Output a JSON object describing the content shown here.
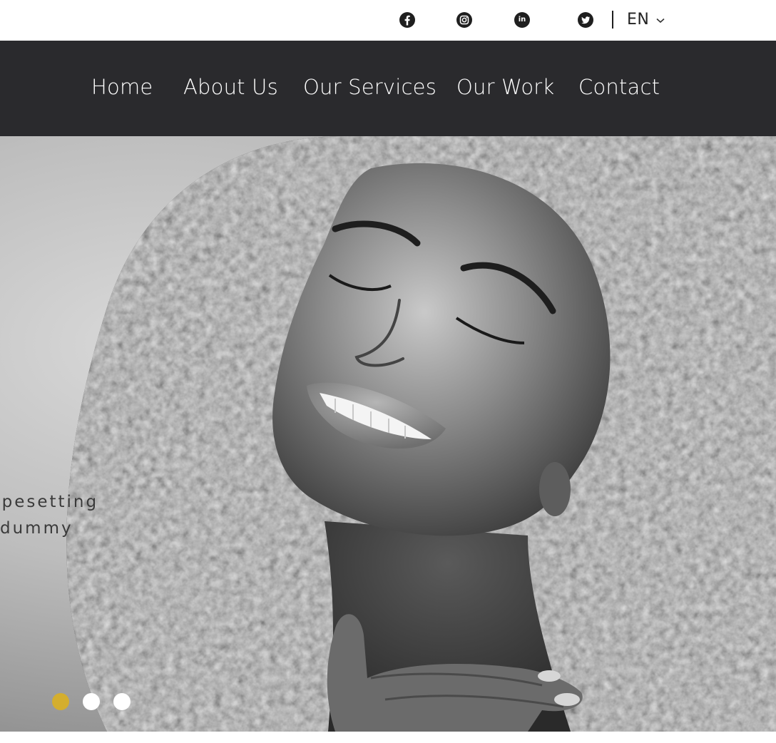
{
  "social": [
    {
      "name": "facebook",
      "icon": "facebook-icon"
    },
    {
      "name": "instagram",
      "icon": "instagram-icon"
    },
    {
      "name": "linkedin",
      "icon": "linkedin-icon",
      "glyph": "in"
    },
    {
      "name": "twitter",
      "icon": "twitter-icon"
    }
  ],
  "language": {
    "code": "EN",
    "icon": "chevron-down-icon"
  },
  "nav": {
    "items": [
      {
        "label": "Home"
      },
      {
        "label": "About Us"
      },
      {
        "label": "Our Services"
      },
      {
        "label": "Our Work"
      },
      {
        "label": "Contact"
      }
    ]
  },
  "hero": {
    "lines": [
      "ypesetting",
      "dummy"
    ],
    "slider": {
      "active_index": 0,
      "count": 3,
      "active_color": "#d4ae2e",
      "inactive_color": "#ffffff"
    }
  },
  "colors": {
    "nav_background": "#2a2a2d",
    "nav_text": "#ffffff",
    "icon_color": "#1f1f1f",
    "accent": "#d4ae2e"
  }
}
